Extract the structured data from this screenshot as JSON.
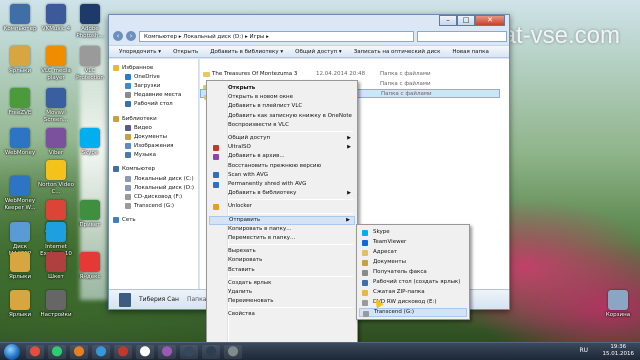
{
  "watermark": "kak-sdelat-vse.com",
  "desktop_icons": [
    {
      "label": "Компьютер",
      "color": "#3f6fa6"
    },
    {
      "label": "VKMusic 4",
      "color": "#3c5a99"
    },
    {
      "label": "Adobe Photosh...",
      "color": "#1e3a6b"
    },
    {
      "label": "Ярлыки",
      "color": "#d7a640"
    },
    {
      "label": "VLC media player",
      "color": "#f08c00"
    },
    {
      "label": "VLC Protection",
      "color": "#9a9a9a"
    },
    {
      "label": "FreeZVE",
      "color": "#4b9b3c"
    },
    {
      "label": "Movavi Screen...",
      "color": "#3a5fa0"
    },
    {
      "label": "WebMoney",
      "color": "#2d74c4"
    },
    {
      "label": "Viber",
      "color": "#7b519d"
    },
    {
      "label": "Skype",
      "color": "#00aff0"
    },
    {
      "label": "Norton Video C...",
      "color": "#f4c21a"
    },
    {
      "label": "WebMoney Keeper W...",
      "color": "#2d74c4"
    },
    {
      "label": "Google Chrome",
      "color": "#db4437"
    },
    {
      "label": "Привет",
      "color": "#3f8f3f"
    },
    {
      "label": "Диск МАСТЕР",
      "color": "#5a9bd5"
    },
    {
      "label": "Internet Explorer 10",
      "color": "#1ea0e0"
    },
    {
      "label": "Ярлыки",
      "color": "#d7a640"
    },
    {
      "label": "Шкет",
      "color": "#b04040"
    },
    {
      "label": "Яндекс",
      "color": "#e53935"
    },
    {
      "label": "Ярлыки",
      "color": "#d7a640"
    },
    {
      "label": "Настройки",
      "color": "#666666"
    },
    {
      "label": "Корзина",
      "color": "#8aa6c4"
    }
  ],
  "window": {
    "address": "Компьютер ▸ Локальный диск (D:) ▸ Игры ▸",
    "toolbar": [
      "Упорядочить ▾",
      "Открыть",
      "Добавить в библиотеку ▾",
      "Общий доступ ▾",
      "Записать на оптический диск",
      "Новая папка"
    ],
    "nav": [
      {
        "label": "Избранное",
        "kind": "group",
        "color": "#e8b83a"
      },
      {
        "label": "OneDrive",
        "kind": "item",
        "color": "#2a7ad2"
      },
      {
        "label": "Загрузки",
        "kind": "item",
        "color": "#3a8ad2"
      },
      {
        "label": "Недавние места",
        "kind": "item",
        "color": "#8a8a8a"
      },
      {
        "label": "Рабочий стол",
        "kind": "item",
        "color": "#3a6fb0"
      },
      {
        "label": "",
        "kind": "spacer",
        "color": ""
      },
      {
        "label": "Библиотеки",
        "kind": "group",
        "color": "#c8a040"
      },
      {
        "label": "Видео",
        "kind": "item",
        "color": "#5a5a8a"
      },
      {
        "label": "Документы",
        "kind": "item",
        "color": "#c8a040"
      },
      {
        "label": "Изображения",
        "kind": "item",
        "color": "#5a8ac8"
      },
      {
        "label": "Музыка",
        "kind": "item",
        "color": "#4a7ab0"
      },
      {
        "label": "",
        "kind": "spacer",
        "color": ""
      },
      {
        "label": "Компьютер",
        "kind": "group",
        "color": "#3f6fa6"
      },
      {
        "label": "Локальный диск (C:)",
        "kind": "item",
        "color": "#8a9ab0"
      },
      {
        "label": "Локальный диск (D:)",
        "kind": "item",
        "color": "#8a9ab0"
      },
      {
        "label": "CD-дисковод (F:)",
        "kind": "item",
        "color": "#9a9a9a"
      },
      {
        "label": "Transcend (G:)",
        "kind": "item",
        "color": "#9a9a9a"
      },
      {
        "label": "",
        "kind": "spacer",
        "color": ""
      },
      {
        "label": "Сеть",
        "kind": "group",
        "color": "#3f7fbf"
      }
    ],
    "files": [
      {
        "name": "The Treasures Of Montezuma 3",
        "date": "12.04.2014 20:48",
        "type": "Папка с файлами",
        "selected": false
      },
      {
        "name": "",
        "date": "",
        "type": "Папка с файлами",
        "selected": false
      },
      {
        "name": "",
        "date": "",
        "type": "Папка с файлами",
        "selected": true
      }
    ],
    "details": {
      "name": "Тиберия Сан",
      "type": "Папка с файлами"
    }
  },
  "context_menu": [
    {
      "label": "Открыть",
      "bold": true,
      "arrow": false,
      "icon": ""
    },
    {
      "label": "Открыть в новом окне",
      "bold": false,
      "arrow": false,
      "icon": ""
    },
    {
      "label": "Добавить в плейлист VLC",
      "bold": false,
      "arrow": false,
      "icon": ""
    },
    {
      "label": "Добавить как записную книжку в OneNote",
      "bold": false,
      "arrow": false,
      "icon": ""
    },
    {
      "label": "Воспроизвести в VLC",
      "bold": false,
      "arrow": false,
      "icon": ""
    },
    {
      "sep": true
    },
    {
      "label": "Общий доступ",
      "bold": false,
      "arrow": true,
      "icon": ""
    },
    {
      "label": "UltraISO",
      "bold": false,
      "arrow": true,
      "icon": "#c0392b"
    },
    {
      "label": "Добавить в архив...",
      "bold": false,
      "arrow": false,
      "icon": "#8e44ad"
    },
    {
      "label": "Восстановить прежнюю версию",
      "bold": false,
      "arrow": false,
      "icon": ""
    },
    {
      "label": "Scan with AVG",
      "bold": false,
      "arrow": false,
      "icon": "#2e6fbf"
    },
    {
      "label": "Permanently shred with AVG",
      "bold": false,
      "arrow": false,
      "icon": "#2e6fbf"
    },
    {
      "label": "Добавить в библиотеку",
      "bold": false,
      "arrow": true,
      "icon": ""
    },
    {
      "sep": true
    },
    {
      "label": "Unlocker",
      "bold": false,
      "arrow": false,
      "icon": "#e0a020"
    },
    {
      "sep": true
    },
    {
      "label": "Отправить",
      "bold": false,
      "arrow": true,
      "icon": "",
      "highlight": true
    },
    {
      "label": "Копировать в папку...",
      "bold": false,
      "arrow": false,
      "icon": ""
    },
    {
      "label": "Переместить в папку...",
      "bold": false,
      "arrow": false,
      "icon": ""
    },
    {
      "sep": true
    },
    {
      "label": "Вырезать",
      "bold": false,
      "arrow": false,
      "icon": ""
    },
    {
      "label": "Копировать",
      "bold": false,
      "arrow": false,
      "icon": ""
    },
    {
      "label": "Вставить",
      "bold": false,
      "arrow": false,
      "icon": ""
    },
    {
      "sep": true
    },
    {
      "label": "Создать ярлык",
      "bold": false,
      "arrow": false,
      "icon": ""
    },
    {
      "label": "Удалить",
      "bold": false,
      "arrow": false,
      "icon": ""
    },
    {
      "label": "Переименовать",
      "bold": false,
      "arrow": false,
      "icon": ""
    },
    {
      "sep": true
    },
    {
      "label": "Свойства",
      "bold": false,
      "arrow": false,
      "icon": ""
    }
  ],
  "sendto_menu": [
    {
      "label": "Skype",
      "icon": "#00aff0",
      "highlight": false
    },
    {
      "label": "TeamViewer",
      "icon": "#0e6ad6",
      "highlight": false
    },
    {
      "label": "Адресат",
      "icon": "#e0c060",
      "highlight": false
    },
    {
      "label": "Документы",
      "icon": "#c8a040",
      "highlight": false
    },
    {
      "label": "Получатель факса",
      "icon": "#8a8a8a",
      "highlight": false
    },
    {
      "label": "Рабочий стол (создать ярлык)",
      "icon": "#3a6fb0",
      "highlight": false
    },
    {
      "label": "Сжатая ZIP-папка",
      "icon": "#e8b83a",
      "highlight": false
    },
    {
      "label": "DVD RW дисковод (E:)",
      "icon": "#9a9a9a",
      "highlight": false
    },
    {
      "label": "Transcend (G:)",
      "icon": "#9a9a9a",
      "highlight": true
    }
  ],
  "taskbar": {
    "apps": [
      "#e74c3c",
      "#2ecc71",
      "#e67e22",
      "#3498db",
      "#c0392b",
      "#ffffff",
      "#9b59b6",
      "#34495e",
      "#2c3e50",
      "#7f8c8d"
    ],
    "lang": "RU",
    "time": "19:36",
    "date": "15.01.2016"
  }
}
